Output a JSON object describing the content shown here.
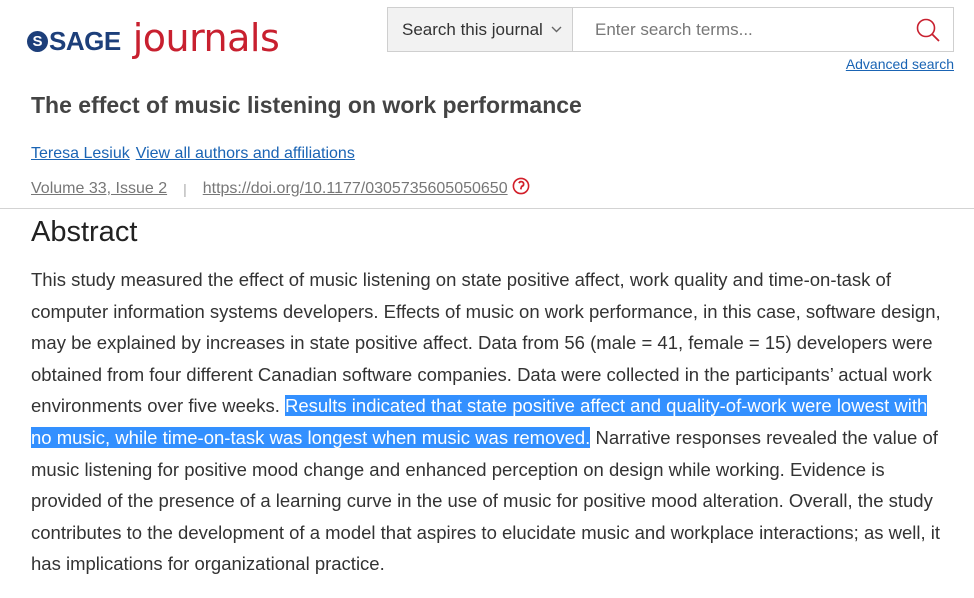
{
  "header": {
    "logo_sage": "SAGE",
    "logo_journals": "journals",
    "search_scope": "Search this journal",
    "search_placeholder": "Enter search terms...",
    "advanced_search": "Advanced search"
  },
  "article": {
    "title": "The effect of music listening on work performance",
    "author": "Teresa Lesiuk",
    "view_all_authors": "View all authors and affiliations",
    "volume_issue": "Volume 33, Issue 2",
    "separator": "|",
    "doi": "https://doi.org/10.1177/0305735605050650"
  },
  "abstract": {
    "heading": "Abstract",
    "text_before": "This study measured the effect of music listening on state positive affect, work quality and time-on-task of computer information systems developers. Effects of music on work performance, in this case, software design, may be explained by increases in state positive affect. Data from 56 (male = 41, female = 15) developers were obtained from four different Canadian software companies. Data were collected in the participants’ actual work environments over five weeks. ",
    "text_highlighted": "Results indicated that state positive affect and quality-of-work were lowest with no music, while time-on-task was longest when music was removed.",
    "text_after": " Narrative responses revealed the value of music listening for positive mood change and enhanced perception on design while working. Evidence is provided of the presence of a learning curve in the use of music for positive mood alteration. Overall, the study contributes to the development of a model that aspires to elucidate music and workplace interactions; as well, it has implications for organizational practice."
  },
  "colors": {
    "brand_blue": "#1d3f7a",
    "brand_red": "#c8202f",
    "link": "#1a64b4",
    "selection": "#3390ff"
  },
  "icons": {
    "search": "search-icon",
    "chevron": "chevron-down-icon",
    "doi": "doi-icon"
  }
}
